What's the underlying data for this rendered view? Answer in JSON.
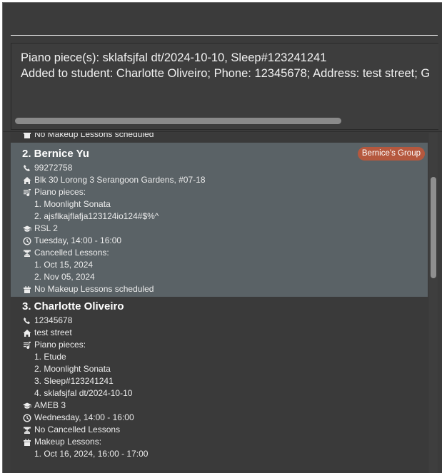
{
  "result": {
    "line1": "Piano piece(s): sklafsjfal dt/2024-10-10, Sleep#123241241",
    "line2": "Added to student: Charlotte Oliveiro; Phone: 12345678; Address: test street; G"
  },
  "previous_card": {
    "makeup_text": "No Makeup Lessons scheduled"
  },
  "students": [
    {
      "name": "2. Bernice Yu",
      "tag": "Bernice's Group",
      "phone": "99272758",
      "address": "Blk 30 Lorong 3 Serangoon Gardens, #07-18",
      "pieces_label": "Piano pieces:",
      "pieces": [
        "1. Moonlight Sonata",
        "2. ajsflkajflafja123124io124#$%^"
      ],
      "grade": "RSL 2",
      "schedule": "Tuesday, 14:00 - 16:00",
      "cancelled_label": "Cancelled Lessons:",
      "cancelled": [
        "1. Oct 15, 2024",
        "2. Nov 05, 2024"
      ],
      "makeup_label": "No Makeup Lessons scheduled",
      "makeup": []
    },
    {
      "name": "3. Charlotte Oliveiro",
      "tag": "",
      "phone": "12345678",
      "address": "test street",
      "pieces_label": "Piano pieces:",
      "pieces": [
        "1. Etude",
        "2. Moonlight Sonata",
        "3. Sleep#123241241",
        "4. sklafsjfal dt/2024-10-10"
      ],
      "grade": "AMEB 3",
      "schedule": "Wednesday, 14:00 - 16:00",
      "cancelled_label": "No Cancelled Lessons",
      "cancelled": [],
      "makeup_label": "Makeup Lessons:",
      "makeup": [
        "1. Oct 16, 2024, 16:00 - 17:00"
      ]
    }
  ]
}
